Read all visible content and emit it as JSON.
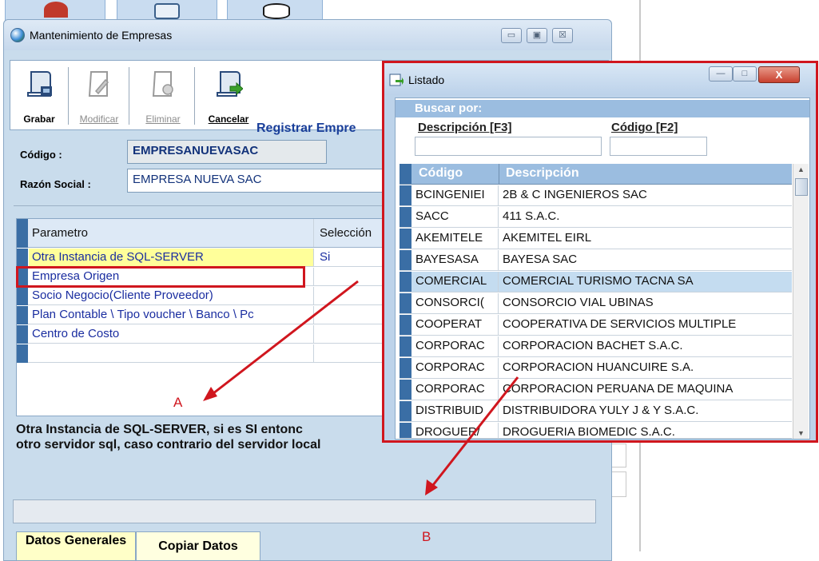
{
  "background": {
    "tab_icons": [
      "app-icon",
      "folder-icon",
      "db-icon"
    ]
  },
  "empresas_window": {
    "title": "Mantenimiento de Empresas",
    "controls": {
      "minimize": "▭",
      "maximize": "▣",
      "close": "☒"
    },
    "toolbar": {
      "grabar": "Grabar",
      "modificar": "Modificar",
      "eliminar": "Eliminar",
      "cancelar": "Cancelar"
    },
    "heading": "Registrar Empre",
    "codigo_label": "Código :",
    "codigo_value": "EMPRESANUEVASAC",
    "razon_label": "Razón Social :",
    "razon_value": "EMPRESA NUEVA SAC",
    "grid": {
      "headers": {
        "param": "Parametro",
        "sel": "Selección"
      },
      "rows": [
        {
          "param": "Otra Instancia de SQL-SERVER",
          "sel": "Si"
        },
        {
          "param": "Empresa Origen",
          "sel": ""
        },
        {
          "param": "Socio Negocio(Cliente Proveedor)",
          "sel": ""
        },
        {
          "param": "Plan Contable \\ Tipo voucher \\ Banco \\ Pc",
          "sel": ""
        },
        {
          "param": "Centro de Costo",
          "sel": ""
        },
        {
          "param": "",
          "sel": ""
        }
      ]
    },
    "description": "Otra Instancia de SQL-SERVER, si es SI entonc\notro servidor sql, caso contrario del servidor local",
    "tabs": {
      "datos_generales": "Datos Generales",
      "copiar_datos": "Copiar Datos"
    }
  },
  "listado_window": {
    "title": "Listado",
    "buscar_por": "Buscar por:",
    "desc_label": "Descripción [F3]",
    "codigo_label": "Código [F2]",
    "columns": {
      "codigo": "Código",
      "descripcion": "Descripción"
    },
    "rows": [
      {
        "codigo": "BCINGENIEI",
        "descripcion": "2B & C INGENIEROS SAC"
      },
      {
        "codigo": "SACC",
        "descripcion": "411  S.A.C."
      },
      {
        "codigo": "AKEMITELE",
        "descripcion": "AKEMITEL EIRL"
      },
      {
        "codigo": "BAYESASA",
        "descripcion": "BAYESA SAC"
      },
      {
        "codigo": "COMERCIAL",
        "descripcion": "COMERCIAL TURISMO TACNA SA"
      },
      {
        "codigo": "CONSORCI(",
        "descripcion": "CONSORCIO VIAL UBINAS"
      },
      {
        "codigo": "COOPERAT",
        "descripcion": "COOPERATIVA DE SERVICIOS MULTIPLE"
      },
      {
        "codigo": "CORPORAC",
        "descripcion": "CORPORACION BACHET S.A.C."
      },
      {
        "codigo": "CORPORAC",
        "descripcion": "CORPORACION HUANCUIRE S.A."
      },
      {
        "codigo": "CORPORAC",
        "descripcion": "CORPORACION PERUANA DE MAQUINA"
      },
      {
        "codigo": "DISTRIBUID",
        "descripcion": "DISTRIBUIDORA YULY  J & Y  S.A.C."
      },
      {
        "codigo": "DROGUER/",
        "descripcion": "DROGUERIA BIOMEDIC S.A.C."
      }
    ],
    "selected_row": 4
  },
  "annotations": {
    "a": "A",
    "b": "B"
  },
  "colors": {
    "highlight": "#d0161e",
    "link": "#1a3f9a"
  }
}
